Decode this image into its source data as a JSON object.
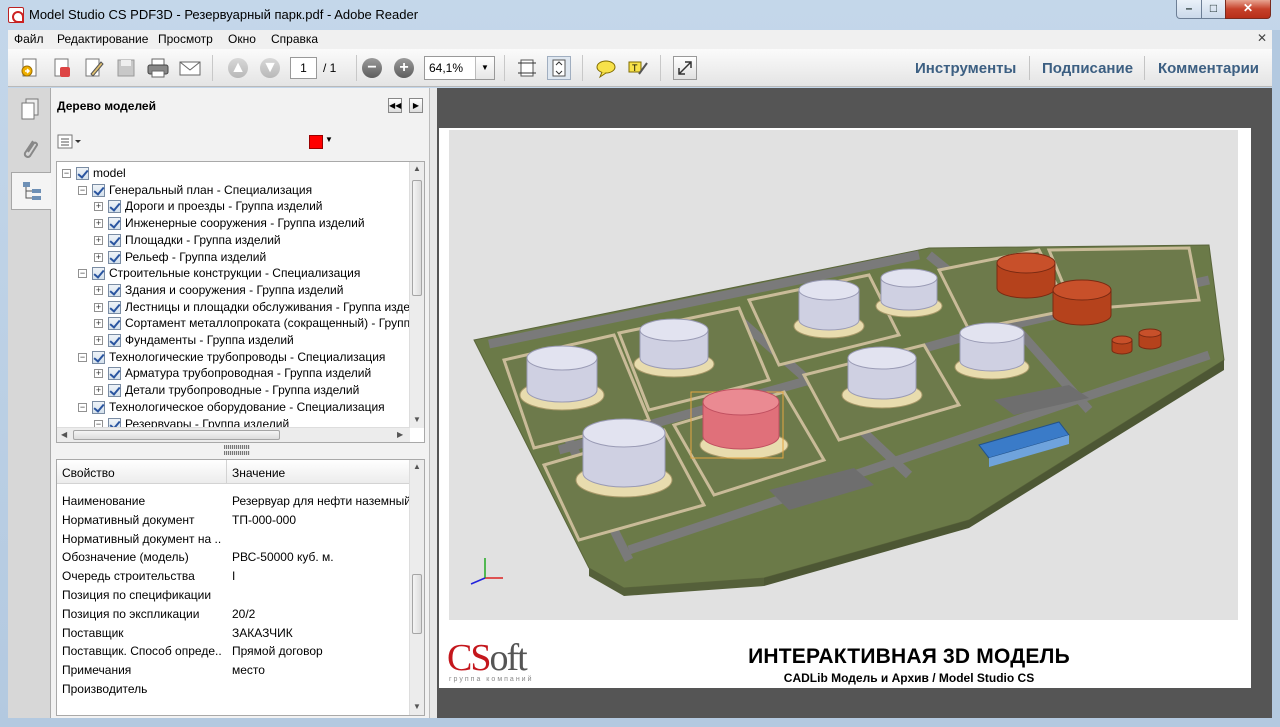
{
  "window": {
    "title": "Model Studio CS PDF3D - Резервуарный парк.pdf - Adobe Reader",
    "minimize_glyph": "–",
    "maximize_glyph": "□",
    "close_glyph": "✕"
  },
  "menu": [
    "Файл",
    "Редактирование",
    "Просмотр",
    "Окно",
    "Справка"
  ],
  "menu_close": "✕",
  "toolbar": {
    "page_current": "1",
    "page_total": "/ 1",
    "zoom": "64,1%",
    "zoom_minus": "−",
    "zoom_plus": "+",
    "links": [
      "Инструменты",
      "Подписание",
      "Комментарии"
    ]
  },
  "panel": {
    "title": "Дерево моделей",
    "tree": [
      {
        "label": "model",
        "level": 0,
        "expander": "−"
      },
      {
        "label": "Генеральный план - Специализация",
        "level": 1,
        "expander": "−"
      },
      {
        "label": "Дороги и проезды - Группа изделий",
        "level": 2,
        "expander": "+"
      },
      {
        "label": "Инженерные сооружения - Группа изделий",
        "level": 2,
        "expander": "+"
      },
      {
        "label": "Площадки - Группа изделий",
        "level": 2,
        "expander": "+"
      },
      {
        "label": "Рельеф - Группа изделий",
        "level": 2,
        "expander": "+"
      },
      {
        "label": "Строительные конструкции - Специализация",
        "level": 1,
        "expander": "−"
      },
      {
        "label": "Здания и сооружения - Группа изделий",
        "level": 2,
        "expander": "+"
      },
      {
        "label": "Лестницы и площадки обслуживания - Группа изде",
        "level": 2,
        "expander": "+"
      },
      {
        "label": "Сортамент металлопроката (сокращенный) - Групп",
        "level": 2,
        "expander": "+"
      },
      {
        "label": "Фундаменты - Группа изделий",
        "level": 2,
        "expander": "+"
      },
      {
        "label": "Технологические трубопроводы - Специализация",
        "level": 1,
        "expander": "−"
      },
      {
        "label": "Арматура трубопроводная - Группа изделий",
        "level": 2,
        "expander": "+"
      },
      {
        "label": "Детали трубопроводные - Группа изделий",
        "level": 2,
        "expander": "+"
      },
      {
        "label": "Технологическое оборудование - Специализация",
        "level": 1,
        "expander": "−"
      },
      {
        "label": "Резервуары - Группа изделий",
        "level": 2,
        "expander": "−"
      }
    ],
    "props_header": {
      "key": "Свойство",
      "value": "Значение"
    },
    "props": [
      {
        "k": "Наименование",
        "v": "Резервуар для нефти наземный с"
      },
      {
        "k": "Нормативный документ",
        "v": "ТП-000-000"
      },
      {
        "k": "Нормативный документ на ...",
        "v": ""
      },
      {
        "k": "Обозначение (модель)",
        "v": "РВС-50000 куб. м."
      },
      {
        "k": "Очередь строительства",
        "v": "I"
      },
      {
        "k": "Позиция по спецификации",
        "v": ""
      },
      {
        "k": "Позиция по экспликации",
        "v": "20/2"
      },
      {
        "k": "Поставщик",
        "v": "ЗАКАЗЧИК"
      },
      {
        "k": "Поставщик. Способ опреде...",
        "v": "Прямой договор"
      },
      {
        "k": "Примечания",
        "v": "место"
      },
      {
        "k": "Производитель",
        "v": ""
      }
    ]
  },
  "document": {
    "heading": "ИНТЕРАКТИВНАЯ 3D МОДЕЛЬ",
    "subheading": "CADLib Модель и Архив / Model Studio CS",
    "logo_cs": "CS",
    "logo_oft": "oft",
    "logo_sub": "группа компаний"
  },
  "colors": {
    "accent_links": "#3c5f82",
    "logo_red": "#c4161c",
    "selected_tank": "#e0707a",
    "terrain": "#6b7a48",
    "swatch": "#ff0000"
  }
}
